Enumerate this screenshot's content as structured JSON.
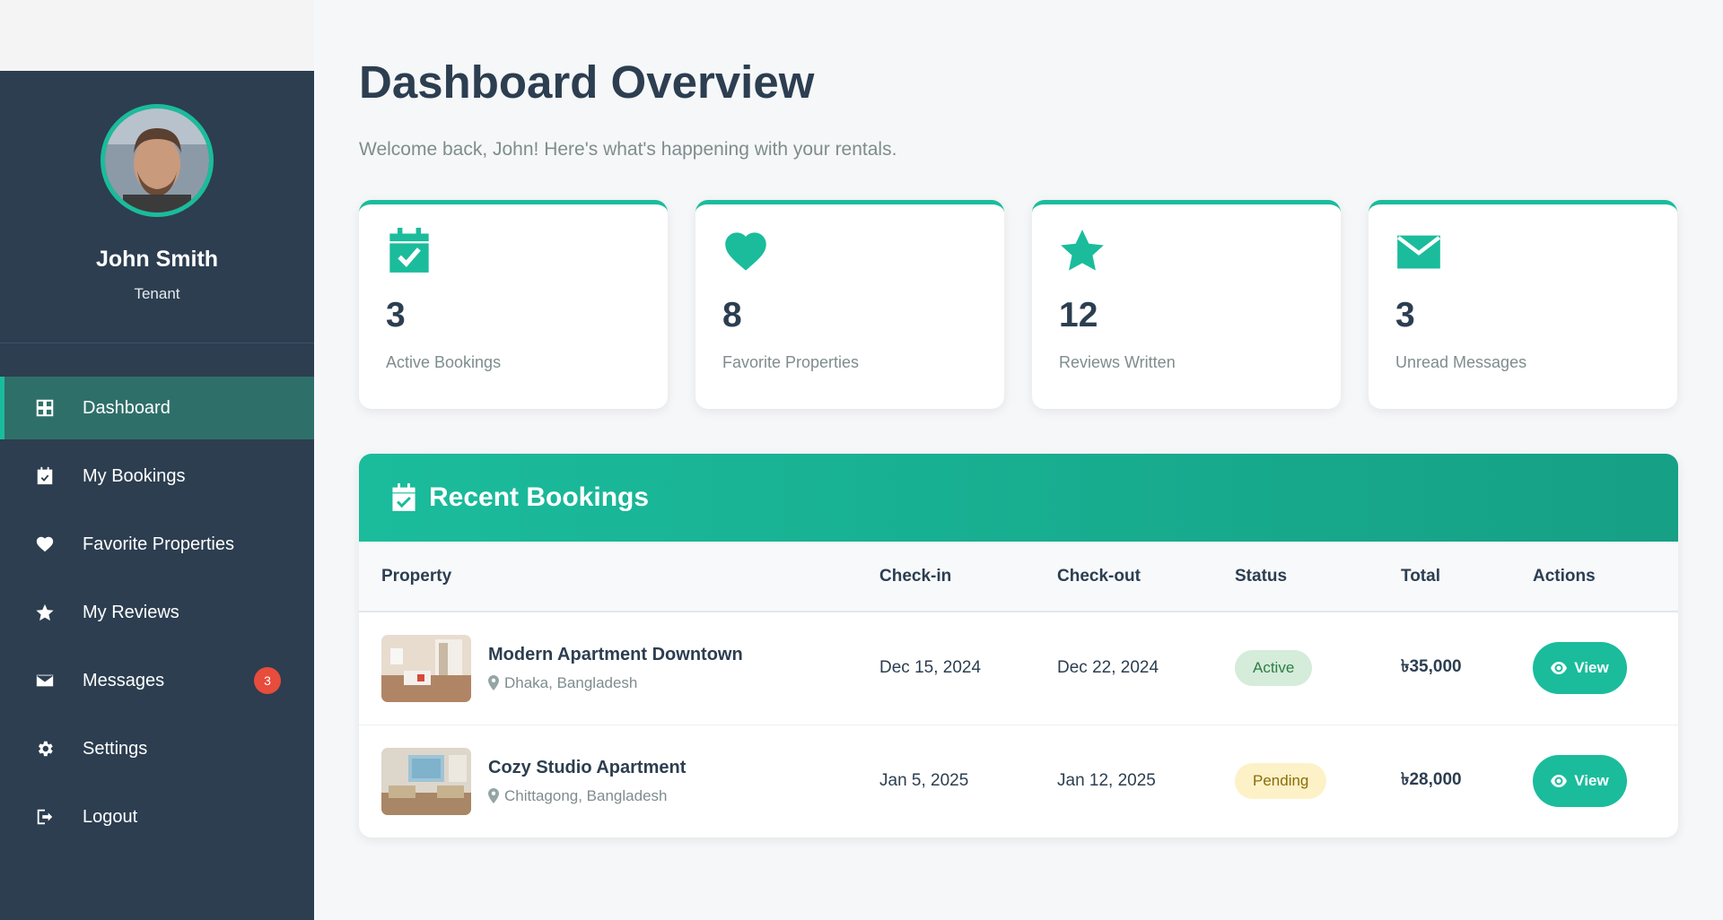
{
  "profile": {
    "name": "John Smith",
    "role": "Tenant"
  },
  "sidebar": {
    "items": [
      {
        "label": "Dashboard",
        "icon": "grid-icon",
        "active": true
      },
      {
        "label": "My Bookings",
        "icon": "calendar-check-icon"
      },
      {
        "label": "Favorite Properties",
        "icon": "heart-icon"
      },
      {
        "label": "My Reviews",
        "icon": "star-icon"
      },
      {
        "label": "Messages",
        "icon": "envelope-icon",
        "badge": "3"
      },
      {
        "label": "Settings",
        "icon": "gear-icon"
      },
      {
        "label": "Logout",
        "icon": "logout-icon"
      }
    ]
  },
  "header": {
    "title": "Dashboard Overview",
    "subtitle": "Welcome back, John! Here's what's happening with your rentals."
  },
  "stats": [
    {
      "value": "3",
      "label": "Active Bookings",
      "icon": "calendar-check-icon"
    },
    {
      "value": "8",
      "label": "Favorite Properties",
      "icon": "heart-icon"
    },
    {
      "value": "12",
      "label": "Reviews Written",
      "icon": "star-icon"
    },
    {
      "value": "3",
      "label": "Unread Messages",
      "icon": "envelope-icon"
    }
  ],
  "bookings": {
    "title": "Recent Bookings",
    "columns": [
      "Property",
      "Check-in",
      "Check-out",
      "Status",
      "Total",
      "Actions"
    ],
    "rows": [
      {
        "property": "Modern Apartment Downtown",
        "location": "Dhaka, Bangladesh",
        "checkin": "Dec 15, 2024",
        "checkout": "Dec 22, 2024",
        "status": "Active",
        "total": "৳35,000",
        "action": "View"
      },
      {
        "property": "Cozy Studio Apartment",
        "location": "Chittagong, Bangladesh",
        "checkin": "Jan 5, 2025",
        "checkout": "Jan 12, 2025",
        "status": "Pending",
        "total": "৳28,000",
        "action": "View"
      }
    ]
  },
  "colors": {
    "accent": "#1abc9c",
    "sidebar_bg": "#2c3e50",
    "badge_red": "#e74c3c"
  }
}
